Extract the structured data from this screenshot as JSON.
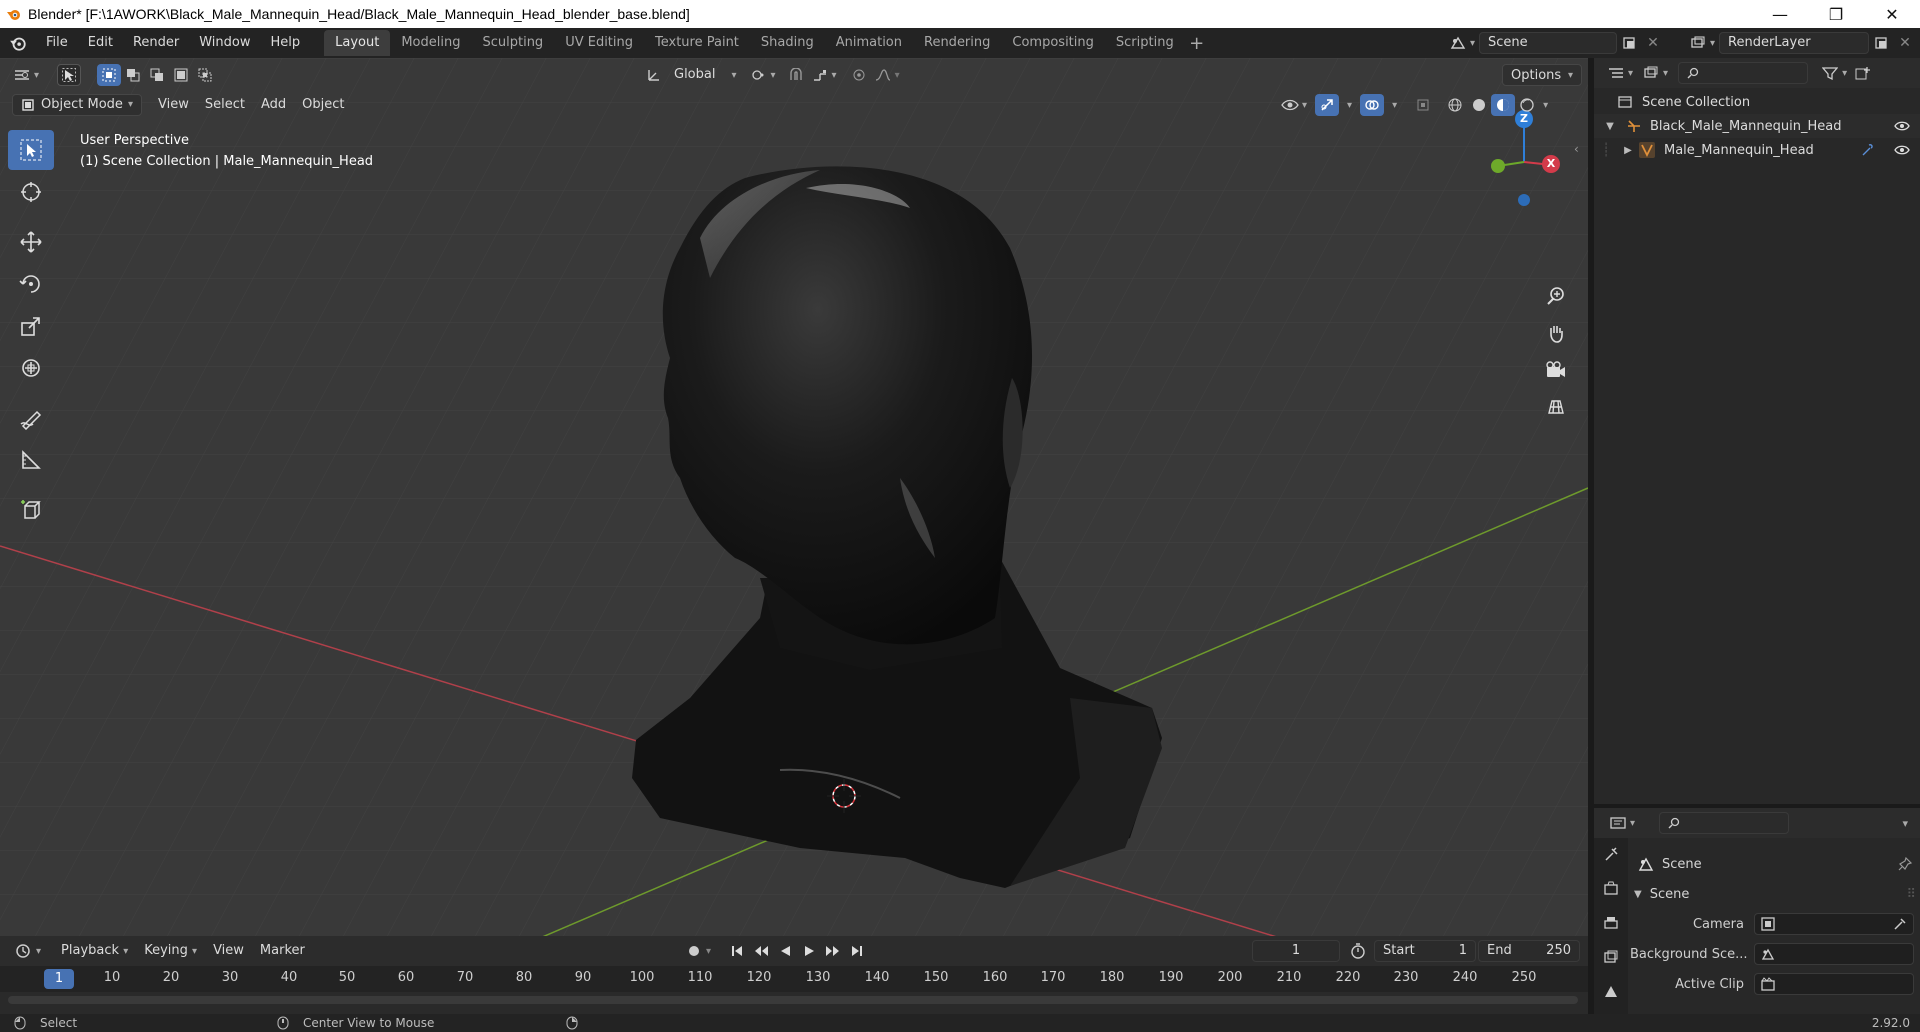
{
  "window": {
    "title": "Blender* [F:\\1AWORK\\Black_Male_Mannequin_Head/Black_Male_Mannequin_Head_blender_base.blend]",
    "minimize": "—",
    "maximize": "❐",
    "close": "✕"
  },
  "menus": [
    "File",
    "Edit",
    "Render",
    "Window",
    "Help"
  ],
  "workspaces": [
    "Layout",
    "Modeling",
    "Sculpting",
    "UV Editing",
    "Texture Paint",
    "Shading",
    "Animation",
    "Rendering",
    "Compositing",
    "Scripting"
  ],
  "active_workspace": "Layout",
  "scene_field": "Scene",
  "renderlayer_field": "RenderLayer",
  "viewport": {
    "mode": "Object Mode",
    "menus": [
      "View",
      "Select",
      "Add",
      "Object"
    ],
    "transform_orientation": "Global",
    "options": "Options",
    "info_line1": "User Perspective",
    "info_line2": "(1) Scene Collection | Male_Mannequin_Head",
    "gizmo": {
      "z": "Z",
      "x": "X"
    }
  },
  "timeline": {
    "menus": [
      "Playback",
      "Keying",
      "View",
      "Marker"
    ],
    "current_frame": "1",
    "start_label": "Start",
    "start": "1",
    "end_label": "End",
    "end": "250",
    "ticks": [
      "1",
      "10",
      "20",
      "30",
      "40",
      "50",
      "60",
      "70",
      "80",
      "90",
      "100",
      "110",
      "120",
      "130",
      "140",
      "150",
      "160",
      "170",
      "180",
      "190",
      "200",
      "210",
      "220",
      "230",
      "240",
      "250"
    ]
  },
  "outliner": {
    "root": "Scene Collection",
    "collection": "Black_Male_Mannequin_Head",
    "object": "Male_Mannequin_Head"
  },
  "properties": {
    "context": "Scene",
    "panel": "Scene",
    "fields": [
      {
        "label": "Camera"
      },
      {
        "label": "Background Sce..."
      },
      {
        "label": "Active Clip"
      }
    ]
  },
  "status": {
    "select": "Select",
    "center": "Center View to Mouse",
    "version": "2.92.0"
  },
  "colors": {
    "accent": "#4772b3",
    "x_axis": "#ff3352",
    "y_axis": "#8bdc00",
    "z_axis": "#2890ff"
  }
}
